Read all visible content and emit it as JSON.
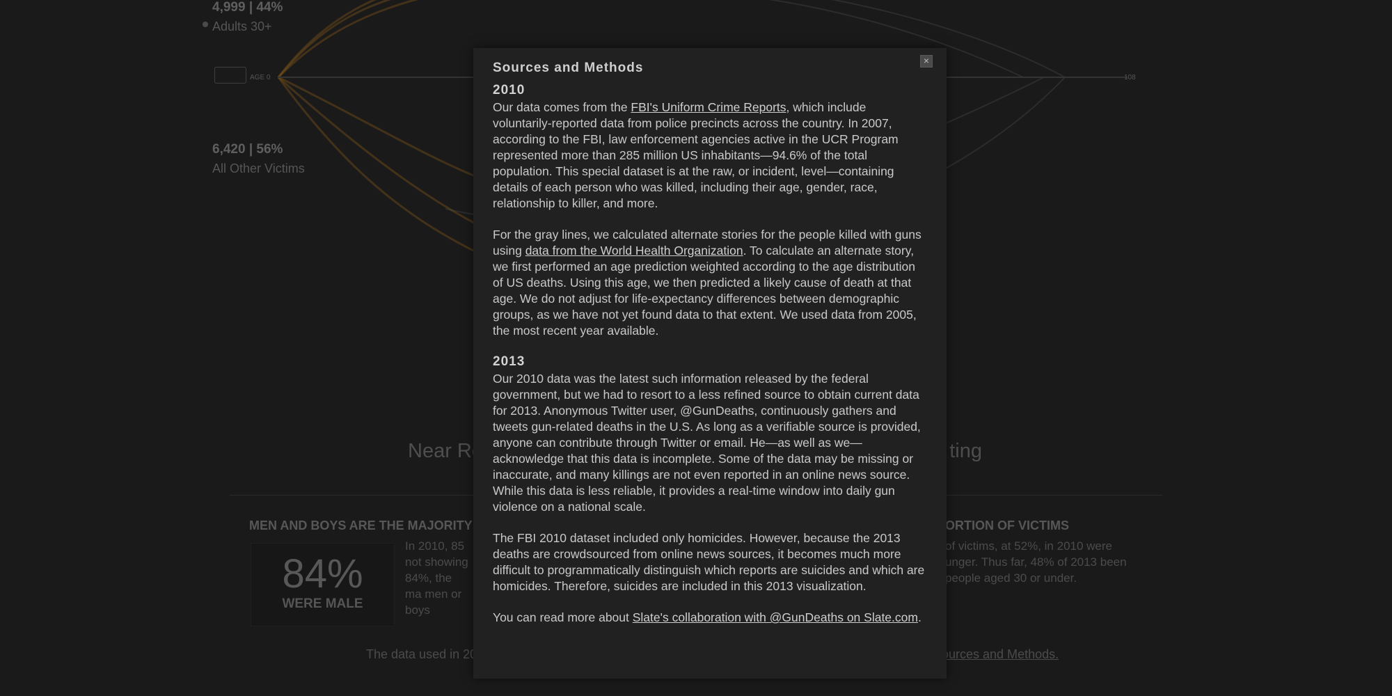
{
  "background": {
    "adults_stat": {
      "value": "4,999 | 44%",
      "label": "Adults 30+"
    },
    "other_stat": {
      "value": "6,420 | 56%",
      "label": "All Other Victims"
    },
    "axis": {
      "start_label": "AGE 0",
      "end_label": "108"
    },
    "subheading": {
      "left": "Near Re",
      "right": "ting"
    },
    "men_heading": "MEN AND BOYS ARE THE MAJORITY",
    "victims_heading": "PORTION OF VICTIMS",
    "men_pct": "84%",
    "men_pct_caption": "WERE MALE",
    "men_text": "In 2010, 85 not showing 84%, the ma men or boys",
    "victims_text": "of victims, at 52%, in 2010 were unger. Thus far, 48% of 2013 been people aged 30 or under.",
    "bottom_note": "The data used in 20",
    "bottom_link": "ources and Methods."
  },
  "modal": {
    "title": "Sources and Methods",
    "close_label": "×",
    "section_2010": {
      "year": "2010",
      "p1_before": "Our data comes from the ",
      "p1_link": "FBI's Uniform Crime Reports",
      "p1_after": ", which include voluntarily-reported data from police precincts across the country. In 2007, according to the FBI, law enforcement agencies active in the UCR Program represented more than 285 million US inhabitants—94.6% of the total population. This special dataset is at the raw, or incident, level—containing details of each person who was killed, including their age, gender, race, relationship to killer, and more.",
      "p2_before": "For the gray lines, we calculated alternate stories for the people killed with guns using ",
      "p2_link": "data from the World Health Organization",
      "p2_after": ". To calculate an alternate story, we first performed an age prediction weighted according to the age distribution of US deaths. Using this age, we then predicted a likely cause of death at that age. We do not adjust for life-expectancy differences between demographic groups, as we have not yet found data to that extent. We used data from 2005, the most recent year available."
    },
    "section_2013": {
      "year": "2013",
      "p1": "Our 2010 data was the latest such information released by the federal government, but we had to resort to a less refined source to obtain current data for 2013. Anonymous Twitter user, @GunDeaths, continuously gathers and tweets gun-related deaths in the U.S. As long as a verifiable source is provided, anyone can contribute through Twitter or email. He—as well as we—acknowledge that this data is incomplete. Some of the data may be missing or inaccurate, and many killings are not even reported in an online news source. While this data is less reliable, it provides a real-time window into daily gun violence on a national scale.",
      "p2": "The FBI 2010 dataset included only homicides. However, because the 2013 deaths are crowdsourced from online news sources, it becomes much more difficult to programmatically distinguish which reports are suicides and which are homicides. Therefore, suicides are included in this 2013 visualization.",
      "p3_before": "You can read more about ",
      "p3_link": "Slate's collaboration with @GunDeaths on Slate.com",
      "p3_after": "."
    }
  },
  "colors": {
    "accent_orange": "#c8841e",
    "gray_lines": "#6a6a6a",
    "modal_bg": "#212121"
  }
}
